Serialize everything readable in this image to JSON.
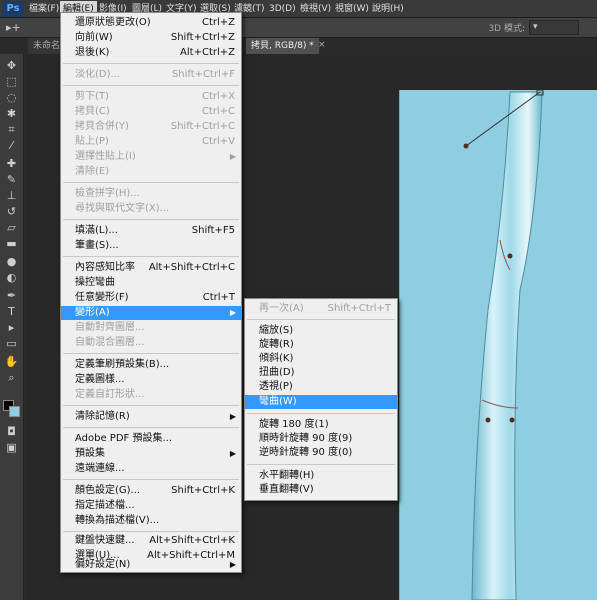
{
  "app": {
    "logo": "Ps"
  },
  "menubar": [
    {
      "label": "檔案(F)",
      "active": false
    },
    {
      "label": "編輯(E)",
      "active": true
    },
    {
      "label": "影像(I)",
      "active": false
    },
    {
      "label": "圖層(L)",
      "active": false
    },
    {
      "label": "文字(Y)",
      "active": false
    },
    {
      "label": "選取(S)",
      "active": false
    },
    {
      "label": "濾鏡(T)",
      "active": false
    },
    {
      "label": "3D(D)",
      "active": false
    },
    {
      "label": "檢視(V)",
      "active": false
    },
    {
      "label": "視窗(W)",
      "active": false
    },
    {
      "label": "說明(H)",
      "active": false
    }
  ],
  "options_bar": {
    "label_3d": "3D 模式:"
  },
  "tabs": [
    {
      "label": "未命名",
      "active": false
    },
    {
      "label": "拷貝, RGB/8) *",
      "active": true
    }
  ],
  "edit_menu": {
    "items": [
      {
        "label": "還原狀態更改(O)",
        "shortcut": "Ctrl+Z",
        "disabled": false,
        "submenu": false
      },
      {
        "label": "向前(W)",
        "shortcut": "Shift+Ctrl+Z",
        "disabled": false,
        "submenu": false
      },
      {
        "label": "退後(K)",
        "shortcut": "Alt+Ctrl+Z",
        "disabled": false,
        "submenu": false
      },
      {
        "label": "淡化(D)...",
        "shortcut": "Shift+Ctrl+F",
        "disabled": true,
        "submenu": false
      },
      {
        "label": "剪下(T)",
        "shortcut": "Ctrl+X",
        "disabled": true,
        "submenu": false
      },
      {
        "label": "拷貝(C)",
        "shortcut": "Ctrl+C",
        "disabled": true,
        "submenu": false
      },
      {
        "label": "拷貝合併(Y)",
        "shortcut": "Shift+Ctrl+C",
        "disabled": true,
        "submenu": false
      },
      {
        "label": "貼上(P)",
        "shortcut": "Ctrl+V",
        "disabled": true,
        "submenu": false
      },
      {
        "label": "選擇性貼上(I)",
        "shortcut": "",
        "disabled": true,
        "submenu": true
      },
      {
        "label": "清除(E)",
        "shortcut": "",
        "disabled": true,
        "submenu": false
      },
      {
        "label": "檢查拼字(H)...",
        "shortcut": "",
        "disabled": true,
        "submenu": false
      },
      {
        "label": "尋找與取代文字(X)...",
        "shortcut": "",
        "disabled": true,
        "submenu": false
      },
      {
        "label": "填滿(L)...",
        "shortcut": "Shift+F5",
        "disabled": false,
        "submenu": false
      },
      {
        "label": "筆畫(S)...",
        "shortcut": "",
        "disabled": false,
        "submenu": false
      },
      {
        "label": "內容感知比率",
        "shortcut": "Alt+Shift+Ctrl+C",
        "disabled": false,
        "submenu": false
      },
      {
        "label": "操控彎曲",
        "shortcut": "",
        "disabled": false,
        "submenu": false
      },
      {
        "label": "任意變形(F)",
        "shortcut": "Ctrl+T",
        "disabled": false,
        "submenu": false
      },
      {
        "label": "變形(A)",
        "shortcut": "",
        "disabled": false,
        "submenu": true,
        "highlighted": true
      },
      {
        "label": "自動對齊圖層...",
        "shortcut": "",
        "disabled": true,
        "submenu": false
      },
      {
        "label": "自動混合圖層...",
        "shortcut": "",
        "disabled": true,
        "submenu": false
      },
      {
        "label": "定義筆刷預設集(B)...",
        "shortcut": "",
        "disabled": false,
        "submenu": false
      },
      {
        "label": "定義圖樣...",
        "shortcut": "",
        "disabled": false,
        "submenu": false
      },
      {
        "label": "定義自訂形狀...",
        "shortcut": "",
        "disabled": true,
        "submenu": false
      },
      {
        "label": "清除記憶(R)",
        "shortcut": "",
        "disabled": false,
        "submenu": true
      },
      {
        "label": "Adobe PDF 預設集...",
        "shortcut": "",
        "disabled": false,
        "submenu": false
      },
      {
        "label": "預設集",
        "shortcut": "",
        "disabled": false,
        "submenu": true
      },
      {
        "label": "遠端連線...",
        "shortcut": "",
        "disabled": false,
        "submenu": false
      },
      {
        "label": "顏色設定(G)...",
        "shortcut": "Shift+Ctrl+K",
        "disabled": false,
        "submenu": false
      },
      {
        "label": "指定描述檔...",
        "shortcut": "",
        "disabled": false,
        "submenu": false
      },
      {
        "label": "轉換為描述檔(V)...",
        "shortcut": "",
        "disabled": false,
        "submenu": false
      },
      {
        "label": "鍵盤快速鍵...",
        "shortcut": "Alt+Shift+Ctrl+K",
        "disabled": false,
        "submenu": false
      },
      {
        "label": "選單(U)...",
        "shortcut": "Alt+Shift+Ctrl+M",
        "disabled": false,
        "submenu": false
      },
      {
        "label": "偏好設定(N)",
        "shortcut": "",
        "disabled": false,
        "submenu": true
      }
    ]
  },
  "transform_submenu": {
    "items": [
      {
        "label": "再一次(A)",
        "shortcut": "Shift+Ctrl+T",
        "disabled": true
      },
      {
        "label": "縮放(S)",
        "shortcut": ""
      },
      {
        "label": "旋轉(R)",
        "shortcut": ""
      },
      {
        "label": "傾斜(K)",
        "shortcut": ""
      },
      {
        "label": "扭曲(D)",
        "shortcut": ""
      },
      {
        "label": "透視(P)",
        "shortcut": ""
      },
      {
        "label": "彎曲(W)",
        "shortcut": "",
        "highlighted": true
      },
      {
        "label": "旋轉 180 度(1)",
        "shortcut": ""
      },
      {
        "label": "順時針旋轉 90 度(9)",
        "shortcut": ""
      },
      {
        "label": "逆時針旋轉 90 度(0)",
        "shortcut": ""
      },
      {
        "label": "水平翻轉(H)",
        "shortcut": ""
      },
      {
        "label": "垂直翻轉(V)",
        "shortcut": ""
      }
    ]
  },
  "colors": {
    "highlight": "#3399ff",
    "canvas_bg": "#8fcde0",
    "panel": "#3c3c3c"
  }
}
